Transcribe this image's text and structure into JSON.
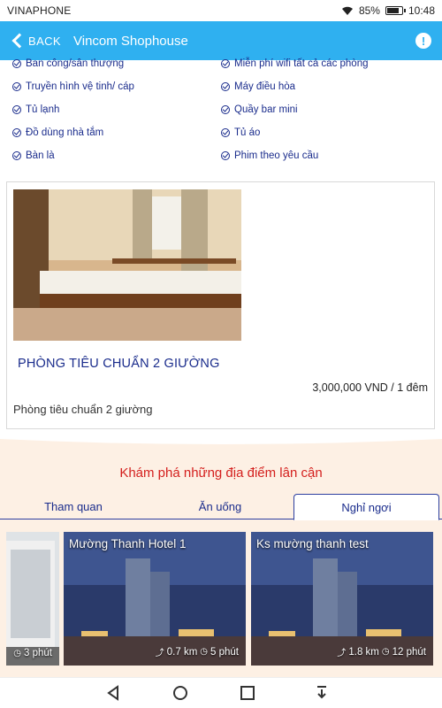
{
  "status_bar": {
    "carrier": "VINAPHONE",
    "battery_text": "85%",
    "battery_level": 0.85,
    "time": "10:48"
  },
  "app_bar": {
    "back_label": "BACK",
    "title": "Vincom Shophouse",
    "accent_color": "#2fb0f0"
  },
  "amenities": [
    "Ban công/sân thượng",
    "Miễn phí wifi tất cả các phòng",
    "Truyền hình vệ tinh/ cáp",
    "Máy điều hòa",
    "Tủ lạnh",
    "Quầy bar mini",
    "Đồ dùng nhà tắm",
    "Tủ áo",
    "Bàn là",
    "Phim theo yêu cầu"
  ],
  "room": {
    "name": "PHÒNG TIÊU CHUẨN 2 GIƯỜNG",
    "price": "3,000,000 VND / 1 đêm",
    "description": "Phòng tiêu chuẩn 2 giường"
  },
  "nearby": {
    "title": "Khám phá những địa điểm lân cận",
    "tabs": [
      "Tham quan",
      "Ăn uống",
      "Nghỉ ngơi"
    ],
    "active_tab": "Nghỉ ngơi",
    "places": [
      {
        "name": "",
        "distance": "",
        "time": "3 phút"
      },
      {
        "name": "Mường Thanh Hotel 1",
        "distance": "0.7 km",
        "time": "5 phút"
      },
      {
        "name": "Ks mường thanh test",
        "distance": "1.8 km",
        "time": "12 phút"
      }
    ]
  }
}
